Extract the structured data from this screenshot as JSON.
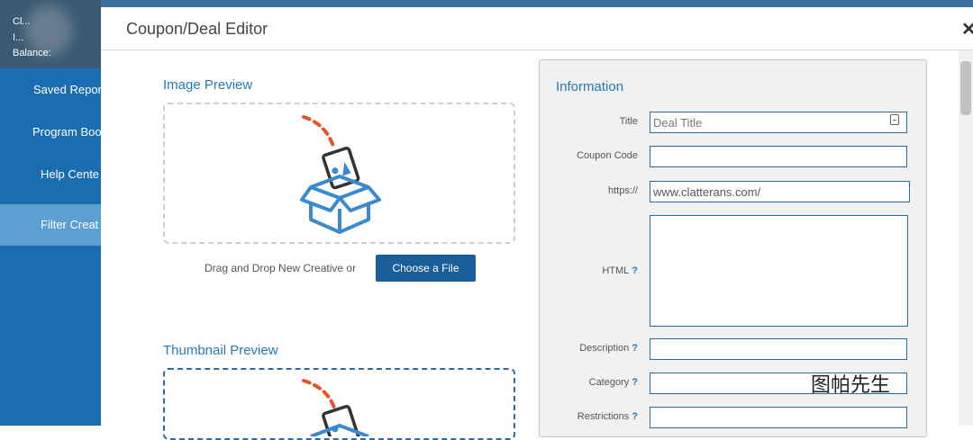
{
  "sidebar": {
    "balance_top": "Cl...",
    "balance_mid": "I...",
    "balance_label": "Balance:",
    "items": [
      {
        "label": "Saved Repor",
        "active": false
      },
      {
        "label": "Program Boo",
        "active": false
      },
      {
        "label": "Help Cente",
        "active": false
      },
      {
        "label": "Filter Creat",
        "active": true
      }
    ]
  },
  "modal": {
    "title": "Coupon/Deal Editor",
    "close_glyph": "✕",
    "image_preview_title": "Image Preview",
    "thumbnail_preview_title": "Thumbnail Preview",
    "drag_drop_text": "Drag and Drop New Creative or",
    "choose_file_label": "Choose a File"
  },
  "info": {
    "title": "Information",
    "fields": {
      "title": {
        "label": "Title",
        "placeholder": "Deal Title",
        "value": ""
      },
      "coupon_code": {
        "label": "Coupon Code",
        "value": ""
      },
      "url": {
        "label": "https://",
        "value": "www.clatterans.com/"
      },
      "html": {
        "label": "HTML",
        "help": "?"
      },
      "description": {
        "label": "Description",
        "help": "?",
        "value": ""
      },
      "category": {
        "label": "Category",
        "help": "?",
        "value": ""
      },
      "restrictions": {
        "label": "Restrictions",
        "help": "?",
        "value": ""
      }
    }
  },
  "watermark": {
    "text": "图帕先生"
  },
  "colors": {
    "sidebar": "#1a6db0",
    "sidebar_active": "#5e9fd1",
    "accent": "#2778b6",
    "button": "#1a5e9a",
    "illustration_orange": "#e5532d",
    "illustration_blue": "#3b8ad0"
  }
}
